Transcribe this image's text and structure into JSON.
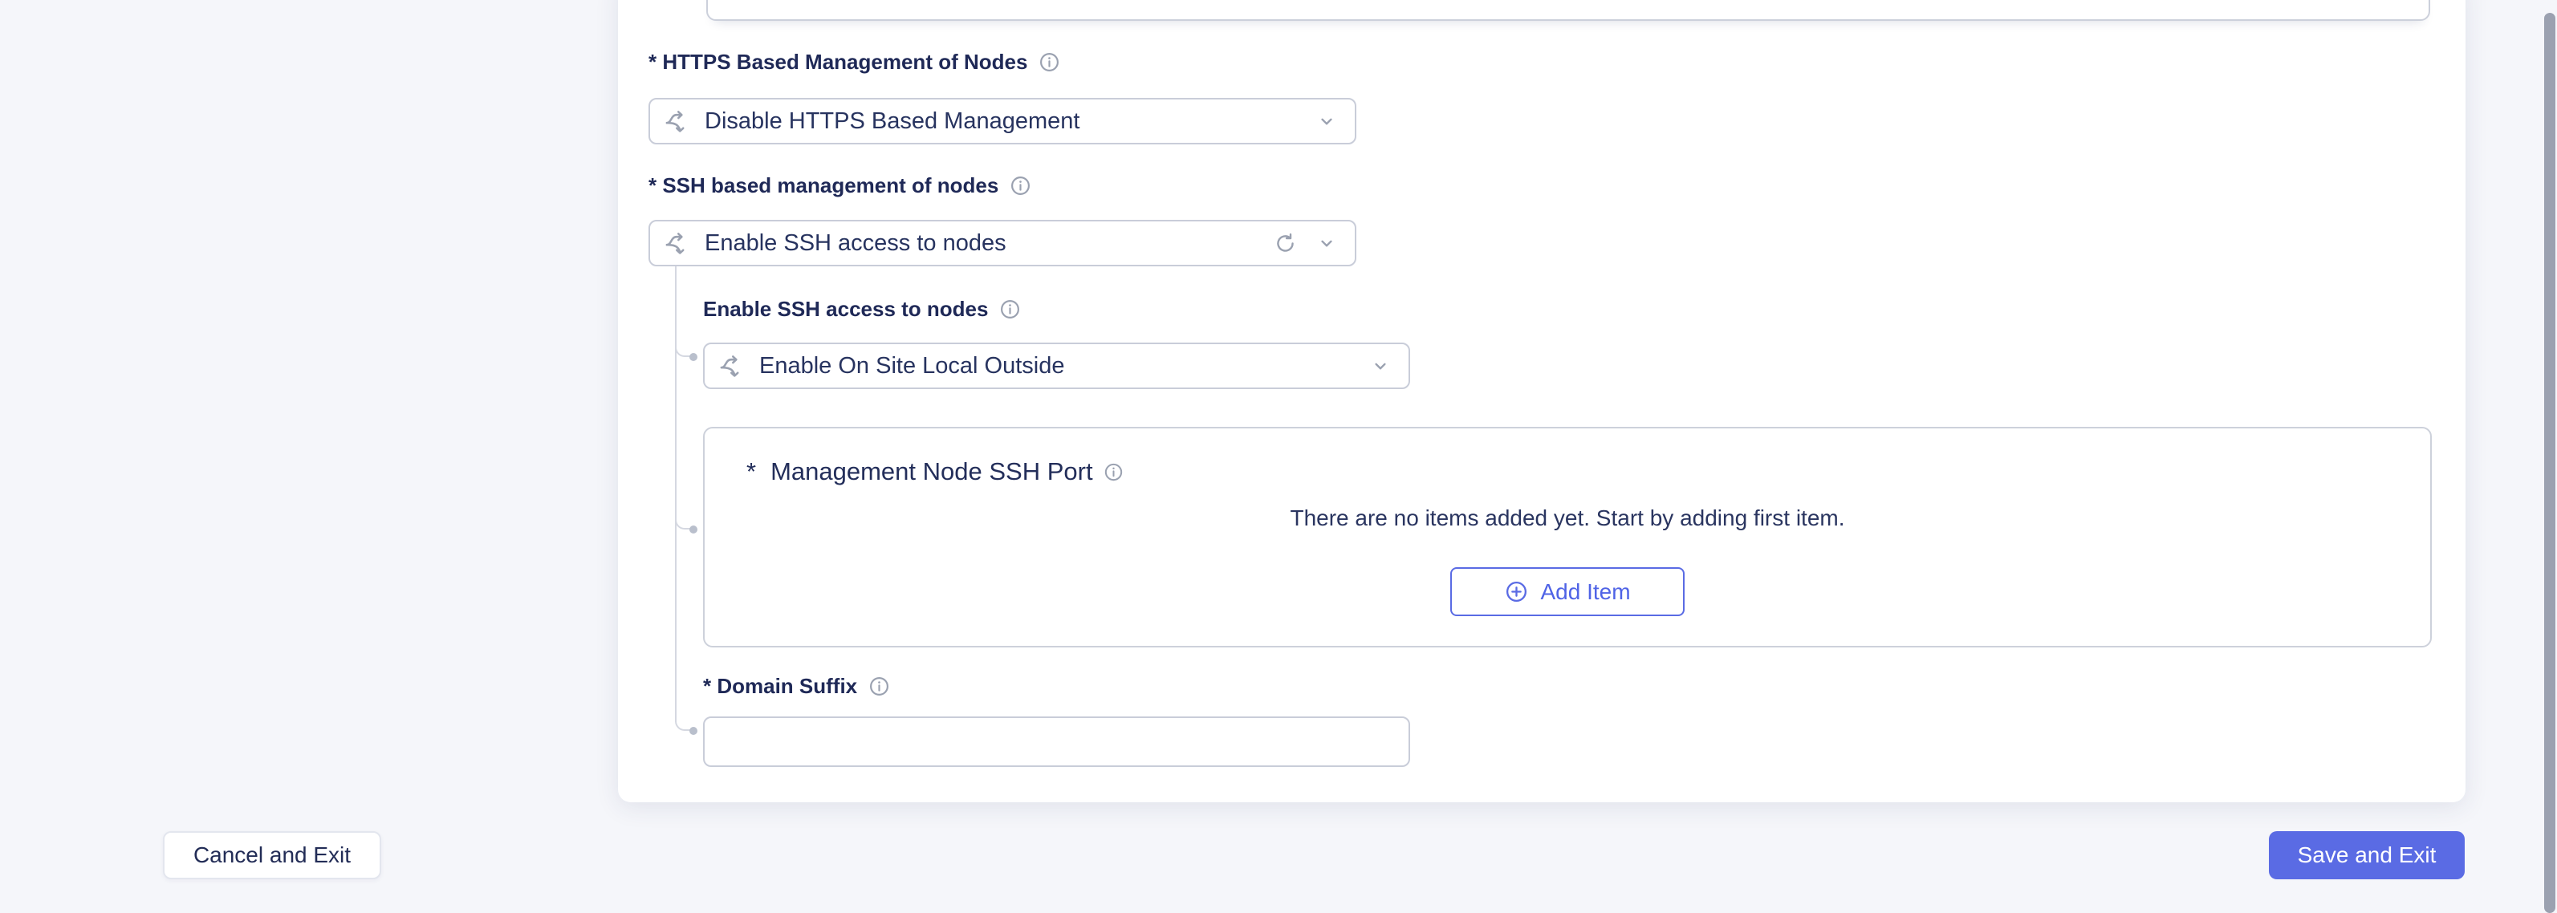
{
  "colors": {
    "accent_blue": "#5a6be4",
    "label_navy": "#1f2957",
    "value_navy": "#27335f",
    "icon_gray": "#9aa1b0",
    "border_gray": "#c9cdd9",
    "page_bg": "#f5f6fa",
    "panel_bg": "#ffffff",
    "scrollbar_gray": "#9ba1b0"
  },
  "form": {
    "top_field": {
      "value": ""
    },
    "https_mgmt": {
      "label": "* HTTPS Based Management of Nodes",
      "selected": "Disable HTTPS Based Management"
    },
    "ssh_mgmt": {
      "label": "* SSH based management of nodes",
      "selected": "Enable SSH access to nodes"
    },
    "ssh_access": {
      "label": "Enable SSH access to nodes",
      "selected": "Enable On Site Local Outside"
    },
    "mgmt_ssh_port": {
      "required_marker": "*",
      "title": "Management Node SSH Port",
      "empty_message": "There are no items added yet. Start by adding first item.",
      "add_item_label": "Add Item"
    },
    "domain_suffix": {
      "label": "* Domain Suffix",
      "value": ""
    }
  },
  "footer": {
    "cancel_label": "Cancel and Exit",
    "save_label": "Save and Exit"
  },
  "icons": {
    "branch": "branch-split-icon",
    "info": "info-icon",
    "chevron": "chevron-down-icon",
    "refresh": "refresh-icon",
    "add": "plus-circle-icon"
  }
}
